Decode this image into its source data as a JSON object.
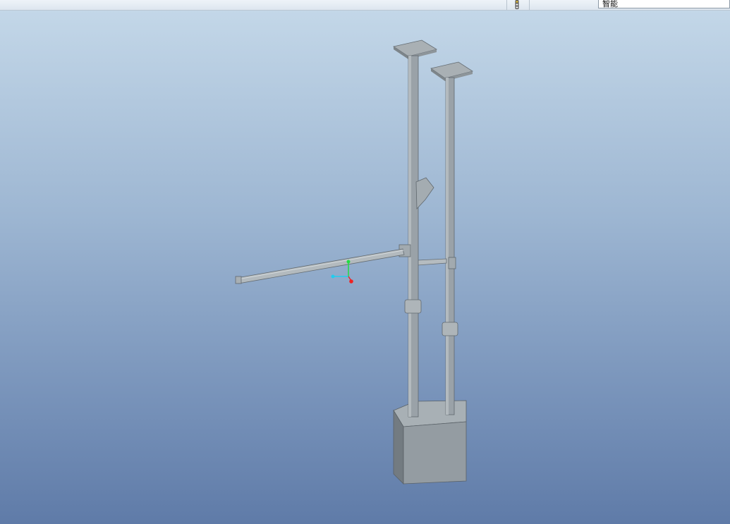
{
  "toolbar": {
    "filter_value": "智能",
    "status_icon": "traffic-light-icon"
  },
  "viewport": {
    "background_top": "#c3d7e8",
    "background_bottom": "#5f7ba8",
    "model_color": "#9aa2a8",
    "axis_colors": {
      "y": "#22dd44",
      "x": "#22ccee",
      "z": "#ee2222"
    }
  }
}
